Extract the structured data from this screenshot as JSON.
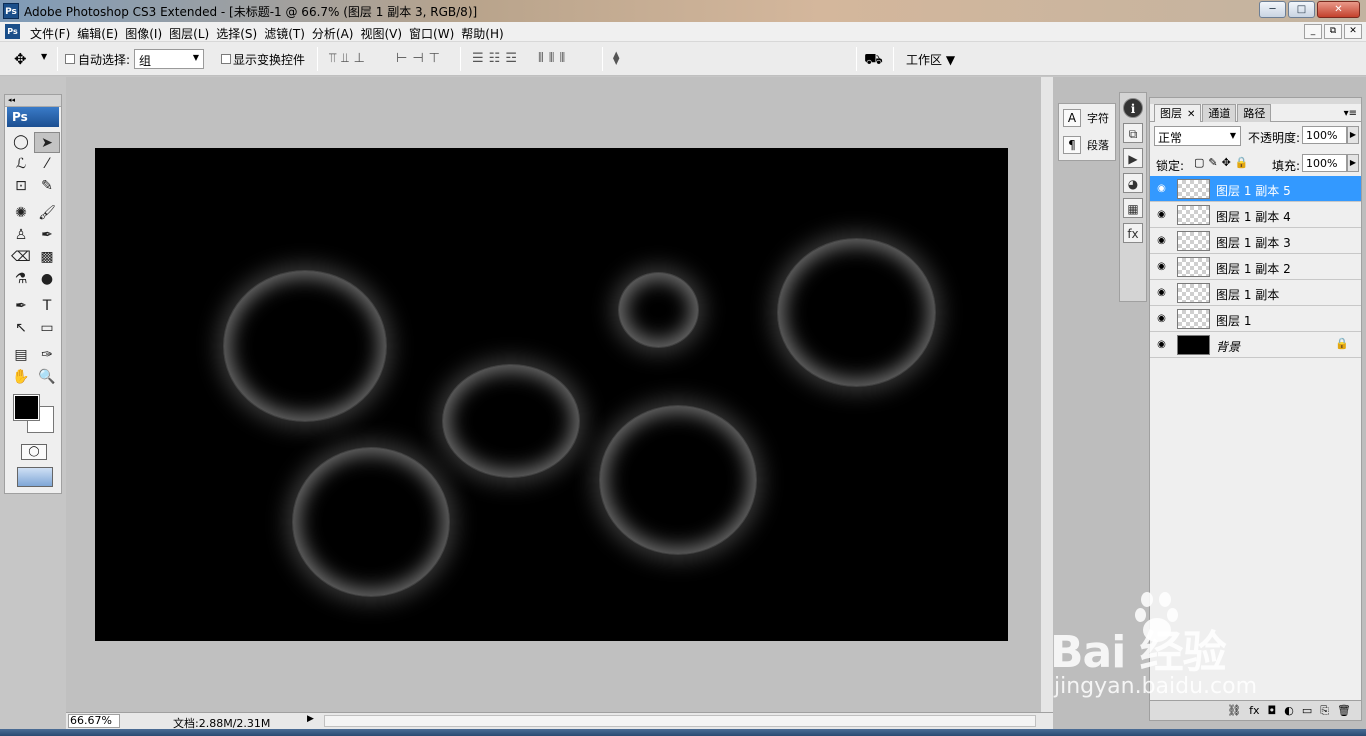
{
  "window": {
    "app_logo": "Ps",
    "title": "Adobe Photoshop CS3 Extended - [未标题-1 @ 66.7% (图层 1 副本 3, RGB/8)]",
    "controls": [
      "─",
      "□",
      "✕"
    ]
  },
  "menubar": {
    "logo": "Ps",
    "items": [
      "文件(F)",
      "编辑(E)",
      "图像(I)",
      "图层(L)",
      "选择(S)",
      "滤镜(T)",
      "分析(A)",
      "视图(V)",
      "窗口(W)",
      "帮助(H)"
    ],
    "mdi_controls": [
      "_",
      "⧉",
      "✕"
    ]
  },
  "options": {
    "tool_icon": "move-tool-icon",
    "auto_select_label": "自动选择:",
    "auto_select_value": "组",
    "show_transform_label": "显示变换控件",
    "workspace_label": "工作区",
    "align_glyphs_1": [
      "⫪",
      "⫫",
      "⊥"
    ],
    "align_glyphs_2": [
      "⊢",
      "⊣",
      "⊤"
    ],
    "distribute_glyphs_1": [
      "☰",
      "☷",
      "☲"
    ],
    "distribute_glyphs_2": [
      "⦀",
      "⦀",
      "⦀"
    ],
    "auto_align_glyph": "⧫"
  },
  "toolbox": {
    "logo": "Ps",
    "tools": [
      "◯",
      "➤",
      "ℒ",
      "⁄",
      "⊡",
      "✎",
      "✺",
      "🖌",
      "♙",
      "✒",
      "⌫",
      "▩",
      "⚗",
      "●",
      "✒",
      "T",
      "↖",
      "▭",
      "▤",
      "✑",
      "✋",
      "🔍"
    ]
  },
  "colors": {
    "foreground": "#000000",
    "background": "#ffffff",
    "selected_layer": "#3399ff",
    "canvas": "#000000"
  },
  "status": {
    "zoom": "66.67%",
    "doc_info": "文档:2.88M/2.31M"
  },
  "side_panel": {
    "character_label": "字符",
    "paragraph_label": "段落",
    "character_icon": "A",
    "paragraph_icon": "¶",
    "strip_icons": [
      "i",
      "⧉",
      "▶",
      "◕",
      "▦",
      "fx"
    ]
  },
  "layers_panel": {
    "tabs": [
      "图层",
      "通道",
      "路径"
    ],
    "blend_mode": "正常",
    "opacity_label": "不透明度:",
    "opacity_value": "100%",
    "lock_label": "锁定:",
    "lock_icons": [
      "▢",
      "✎",
      "✥",
      "🔒"
    ],
    "fill_label": "填充:",
    "fill_value": "100%",
    "layers": [
      {
        "name": "图层 1 副本 5",
        "selected": true
      },
      {
        "name": "图层 1 副本 4",
        "selected": false
      },
      {
        "name": "图层 1 副本 3",
        "selected": false
      },
      {
        "name": "图层 1 副本 2",
        "selected": false
      },
      {
        "name": "图层 1 副本",
        "selected": false
      },
      {
        "name": "图层 1",
        "selected": false
      },
      {
        "name": "背景",
        "selected": false,
        "locked": true
      }
    ],
    "footer_icons": [
      "⛓",
      "fx",
      "◘",
      "◐",
      "▭",
      "⎘",
      "🗑"
    ]
  },
  "watermark": {
    "brand": "Bai  经验",
    "site": "jingyan.baidu.com"
  }
}
